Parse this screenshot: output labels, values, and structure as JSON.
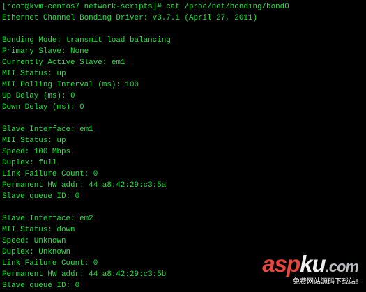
{
  "terminal": {
    "lines": [
      "[root@kvm-centos7 network-scripts]# cat /proc/net/bonding/bond0",
      "Ethernet Channel Bonding Driver: v3.7.1 (April 27, 2011)",
      "",
      "Bonding Mode: transmit load balancing",
      "Primary Slave: None",
      "Currently Active Slave: em1",
      "MII Status: up",
      "MII Polling Interval (ms): 100",
      "Up Delay (ms): 0",
      "Down Delay (ms): 0",
      "",
      "Slave Interface: em1",
      "MII Status: up",
      "Speed: 100 Mbps",
      "Duplex: full",
      "Link Failure Count: 0",
      "Permanent HW addr: 44:a8:42:29:c3:5a",
      "Slave queue ID: 0",
      "",
      "Slave Interface: em2",
      "MII Status: down",
      "Speed: Unknown",
      "Duplex: Unknown",
      "Link Failure Count: 0",
      "Permanent HW addr: 44:a8:42:29:c3:5b",
      "Slave queue ID: 0"
    ]
  },
  "watermark": {
    "logo_part1": "asp",
    "logo_part2": "ku",
    "logo_part3": ".com",
    "subtitle": "免费网站源码下载站!"
  },
  "colors": {
    "background": "#000000",
    "text": "#22e33b",
    "logo_red": "#e8463b"
  }
}
